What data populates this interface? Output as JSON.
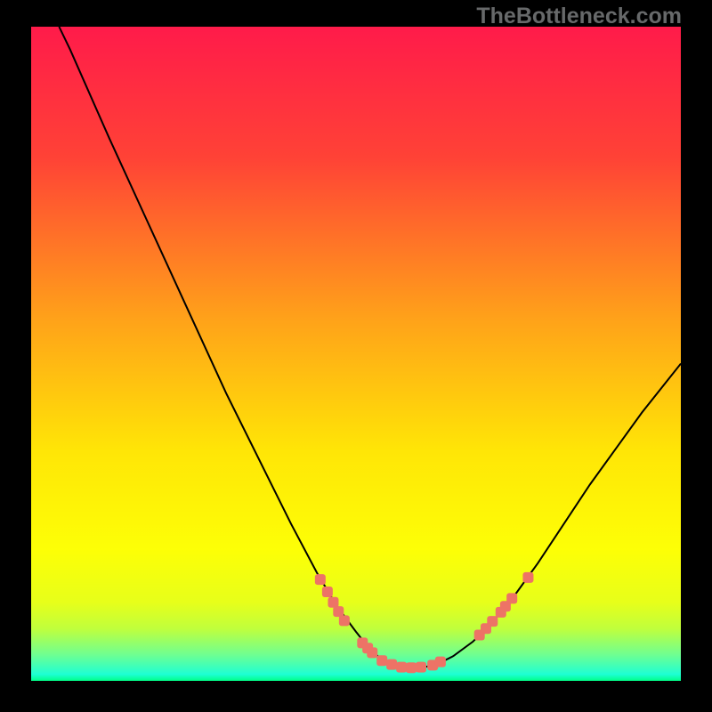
{
  "watermark": "TheBottleneck.com",
  "chart_data": {
    "type": "line",
    "title": "",
    "xlabel": "",
    "ylabel": "",
    "xlim": [
      0,
      100
    ],
    "ylim": [
      0,
      100
    ],
    "gradient_stops": [
      {
        "offset": 0,
        "color": "#ff1b4a"
      },
      {
        "offset": 20,
        "color": "#ff4236"
      },
      {
        "offset": 45,
        "color": "#ffa319"
      },
      {
        "offset": 65,
        "color": "#ffe606"
      },
      {
        "offset": 80,
        "color": "#fdff06"
      },
      {
        "offset": 88,
        "color": "#e7ff1a"
      },
      {
        "offset": 92,
        "color": "#c0ff3c"
      },
      {
        "offset": 96,
        "color": "#6fff91"
      },
      {
        "offset": 99,
        "color": "#1effd4"
      },
      {
        "offset": 100,
        "color": "#00ff87"
      }
    ],
    "curve": [
      {
        "x": 4.3,
        "y": 100.0
      },
      {
        "x": 6.0,
        "y": 96.5
      },
      {
        "x": 8.0,
        "y": 92.0
      },
      {
        "x": 12.0,
        "y": 83.0
      },
      {
        "x": 18.0,
        "y": 70.0
      },
      {
        "x": 24.0,
        "y": 57.0
      },
      {
        "x": 30.0,
        "y": 44.0
      },
      {
        "x": 36.0,
        "y": 32.0
      },
      {
        "x": 40.0,
        "y": 24.0
      },
      {
        "x": 44.0,
        "y": 16.5
      },
      {
        "x": 47.0,
        "y": 11.5
      },
      {
        "x": 50.0,
        "y": 7.5
      },
      {
        "x": 52.0,
        "y": 5.0
      },
      {
        "x": 54.0,
        "y": 3.2
      },
      {
        "x": 56.0,
        "y": 2.3
      },
      {
        "x": 58.5,
        "y": 2.0
      },
      {
        "x": 61.0,
        "y": 2.2
      },
      {
        "x": 63.0,
        "y": 2.8
      },
      {
        "x": 65.0,
        "y": 3.8
      },
      {
        "x": 68.0,
        "y": 6.0
      },
      {
        "x": 71.0,
        "y": 9.0
      },
      {
        "x": 74.0,
        "y": 12.5
      },
      {
        "x": 78.0,
        "y": 18.0
      },
      {
        "x": 82.0,
        "y": 24.0
      },
      {
        "x": 86.0,
        "y": 30.0
      },
      {
        "x": 90.0,
        "y": 35.5
      },
      {
        "x": 94.0,
        "y": 41.0
      },
      {
        "x": 98.0,
        "y": 46.0
      },
      {
        "x": 100.0,
        "y": 48.5
      }
    ],
    "markers": [
      {
        "x": 44.5,
        "y": 15.5
      },
      {
        "x": 45.6,
        "y": 13.6
      },
      {
        "x": 46.5,
        "y": 12.0
      },
      {
        "x": 47.3,
        "y": 10.6
      },
      {
        "x": 48.2,
        "y": 9.2
      },
      {
        "x": 51.0,
        "y": 5.8
      },
      {
        "x": 51.8,
        "y": 5.0
      },
      {
        "x": 52.5,
        "y": 4.3
      },
      {
        "x": 54.0,
        "y": 3.1
      },
      {
        "x": 55.5,
        "y": 2.5
      },
      {
        "x": 57.0,
        "y": 2.1
      },
      {
        "x": 58.5,
        "y": 2.0
      },
      {
        "x": 60.0,
        "y": 2.1
      },
      {
        "x": 61.8,
        "y": 2.4
      },
      {
        "x": 63.0,
        "y": 2.9
      },
      {
        "x": 69.0,
        "y": 7.0
      },
      {
        "x": 70.0,
        "y": 8.0
      },
      {
        "x": 71.0,
        "y": 9.1
      },
      {
        "x": 72.3,
        "y": 10.5
      },
      {
        "x": 73.0,
        "y": 11.4
      },
      {
        "x": 74.0,
        "y": 12.6
      },
      {
        "x": 76.5,
        "y": 15.8
      }
    ],
    "marker_color": "#ed7366",
    "curve_color": "#000000",
    "curve_width": 2
  }
}
